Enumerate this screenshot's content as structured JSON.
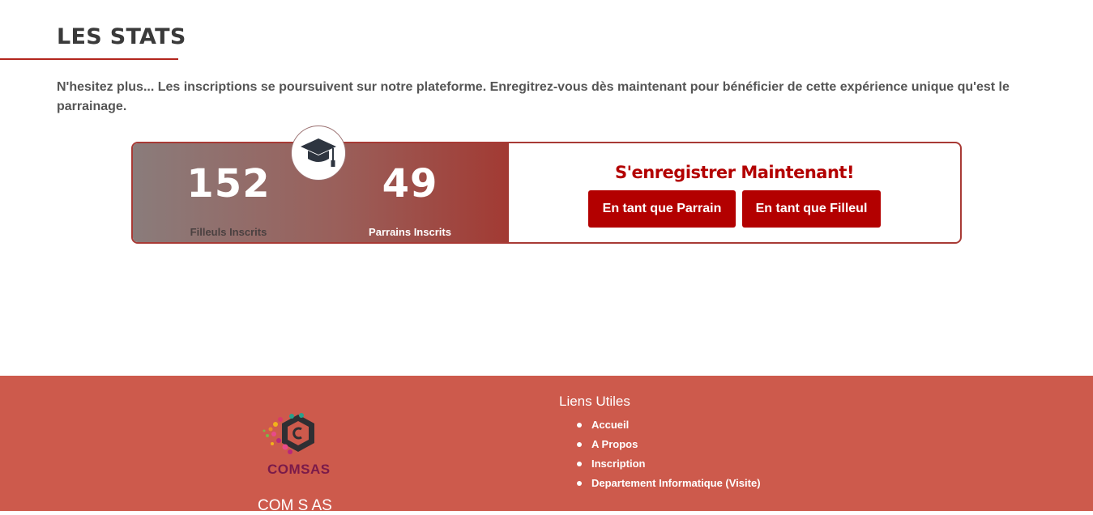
{
  "stats_section": {
    "title": "LES STATS",
    "intro": "N'hesitez plus... Les inscriptions se poursuivent sur notre plateforme. Enregitrez-vous dès maintenant pour bénéficier de cette expérience unique qu'est le parrainage.",
    "badge_icon": "graduation-cap-icon",
    "stats": [
      {
        "value": "152",
        "label": "Filleuls Inscrits"
      },
      {
        "value": "49",
        "label": "Parrains Inscrits"
      }
    ],
    "register": {
      "title": "S'enregistrer Maintenant!",
      "parrain_button": "En tant que Parrain",
      "filleul_button": "En tant que Filleul"
    }
  },
  "footer": {
    "logo_text": "COMSAS",
    "company_name": "COM S AS",
    "links_title": "Liens Utiles",
    "links": [
      "Accueil",
      "A Propos",
      "Inscription",
      "Departement Informatique (Visite)"
    ]
  },
  "colors": {
    "accent": "#b30000",
    "footer_bg": "#cd5a4c",
    "title_underline": "#b3261e"
  }
}
